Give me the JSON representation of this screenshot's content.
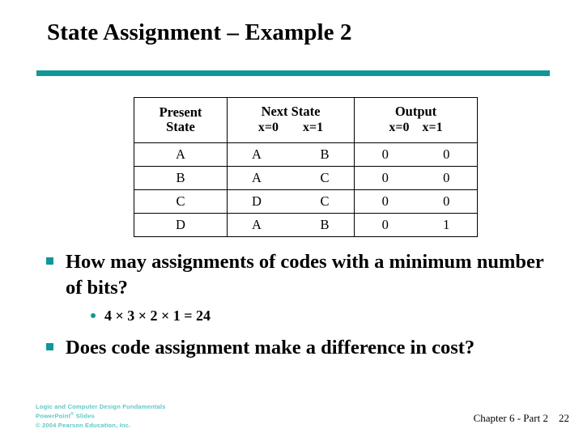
{
  "slide": {
    "title": "State Assignment – Example 2",
    "accent_color": "#119797",
    "logo_color": "#5fc8c8",
    "text_color": "#000000",
    "background": "#ffffff"
  },
  "table": {
    "headers": {
      "present_state_line1": "Present",
      "present_state_line2": "State",
      "next_state_title": "Next State",
      "next_state_x0": "x=0",
      "next_state_x1": "x=1",
      "output_title": "Output",
      "output_x0": "x=0",
      "output_x1": "x=1"
    },
    "rows": [
      {
        "present": "A",
        "next_x0": "A",
        "next_x1": "B",
        "out_x0": "0",
        "out_x1": "0"
      },
      {
        "present": "B",
        "next_x0": "A",
        "next_x1": "C",
        "out_x0": "0",
        "out_x1": "0"
      },
      {
        "present": "C",
        "next_x0": "D",
        "next_x1": "C",
        "out_x0": "0",
        "out_x1": "0"
      },
      {
        "present": "D",
        "next_x0": "A",
        "next_x1": "B",
        "out_x0": "0",
        "out_x1": "1"
      }
    ]
  },
  "body": {
    "bullet1": "How may assignments of codes with a minimum number of bits?",
    "bullet1_sub": "4 × 3 × 2 × 1 = 24",
    "bullet2": "Does code assignment make a difference in cost?"
  },
  "footer": {
    "logo_line1": "Logic and Computer Design Fundamentals",
    "logo_line2_main": "PowerPoint",
    "logo_line2_sup": "®",
    "logo_line2_tail": " Slides",
    "logo_line3": "© 2004 Pearson Education, Inc.",
    "chapter": "Chapter 6 - Part 2",
    "page_number": "22"
  }
}
